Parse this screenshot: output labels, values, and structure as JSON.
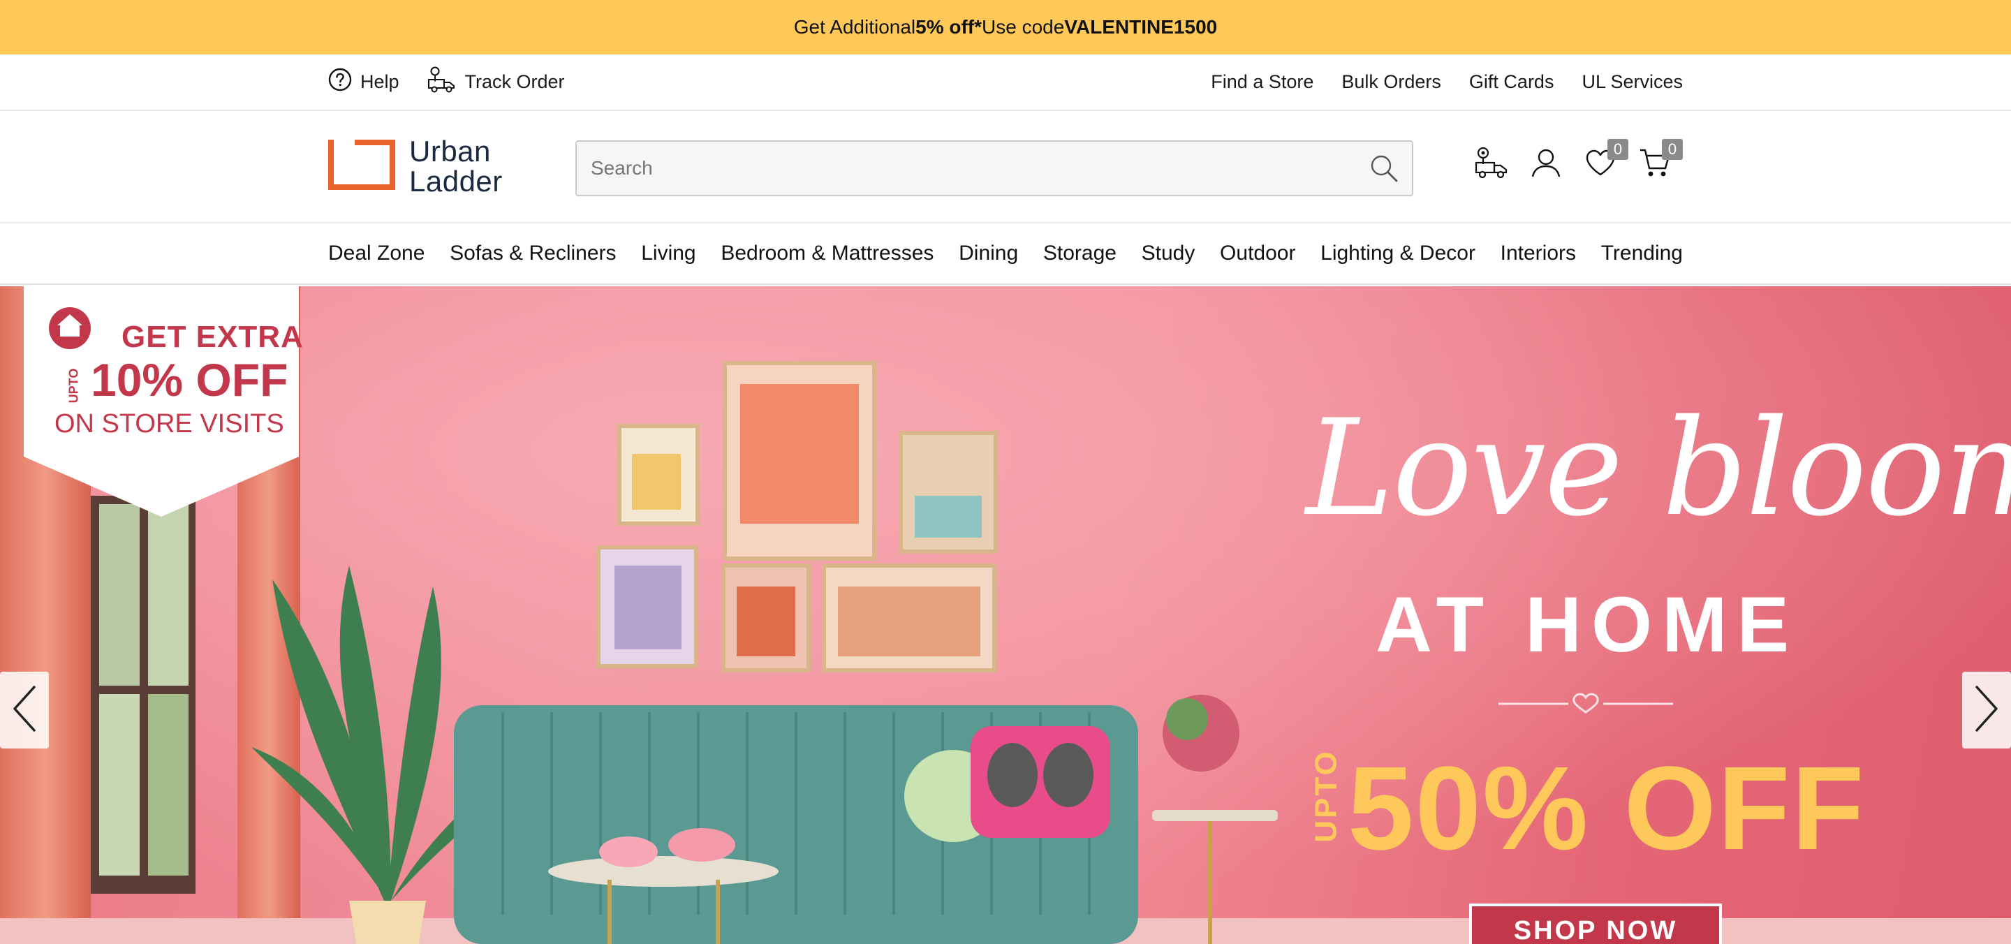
{
  "promo": {
    "prefix": "Get Additional ",
    "highlight": "5% off*",
    "middle": " Use code ",
    "code": "VALENTINE1500"
  },
  "utility": {
    "help_label": "Help",
    "track_order_label": "Track Order",
    "find_store_label": "Find a Store",
    "bulk_orders_label": "Bulk Orders",
    "gift_cards_label": "Gift Cards",
    "ul_services_label": "UL Services"
  },
  "header": {
    "logo_line1": "Urban",
    "logo_line2": "Ladder",
    "search_placeholder": "Search",
    "wishlist_count": "0",
    "cart_count": "0",
    "brand_orange": "#e8622a",
    "brand_navy": "#1b2a41"
  },
  "nav": {
    "items": [
      "Deal Zone",
      "Sofas & Recliners",
      "Living",
      "Bedroom & Mattresses",
      "Dining",
      "Storage",
      "Study",
      "Outdoor",
      "Lighting & Decor",
      "Interiors",
      "Trending"
    ]
  },
  "hero": {
    "badge_get": "GET EXTRA",
    "badge_upto": "UPTO",
    "badge_pct": "10% OFF",
    "badge_visits": "ON STORE VISITS",
    "headline": "Love blooms",
    "subheadline": "AT HOME",
    "offer_upto": "UPTO",
    "offer": "50% OFF",
    "cta": "SHOP NOW",
    "accent_color": "#ffc85a",
    "background_color": "#ef8390"
  },
  "icons": {
    "help": "question-circle-icon",
    "track": "delivery-truck-icon",
    "search": "magnifier-icon",
    "store": "store-locator-icon",
    "user": "user-icon",
    "wishlist": "heart-icon",
    "cart": "cart-icon",
    "prev": "chevron-left-icon",
    "next": "chevron-right-icon"
  }
}
